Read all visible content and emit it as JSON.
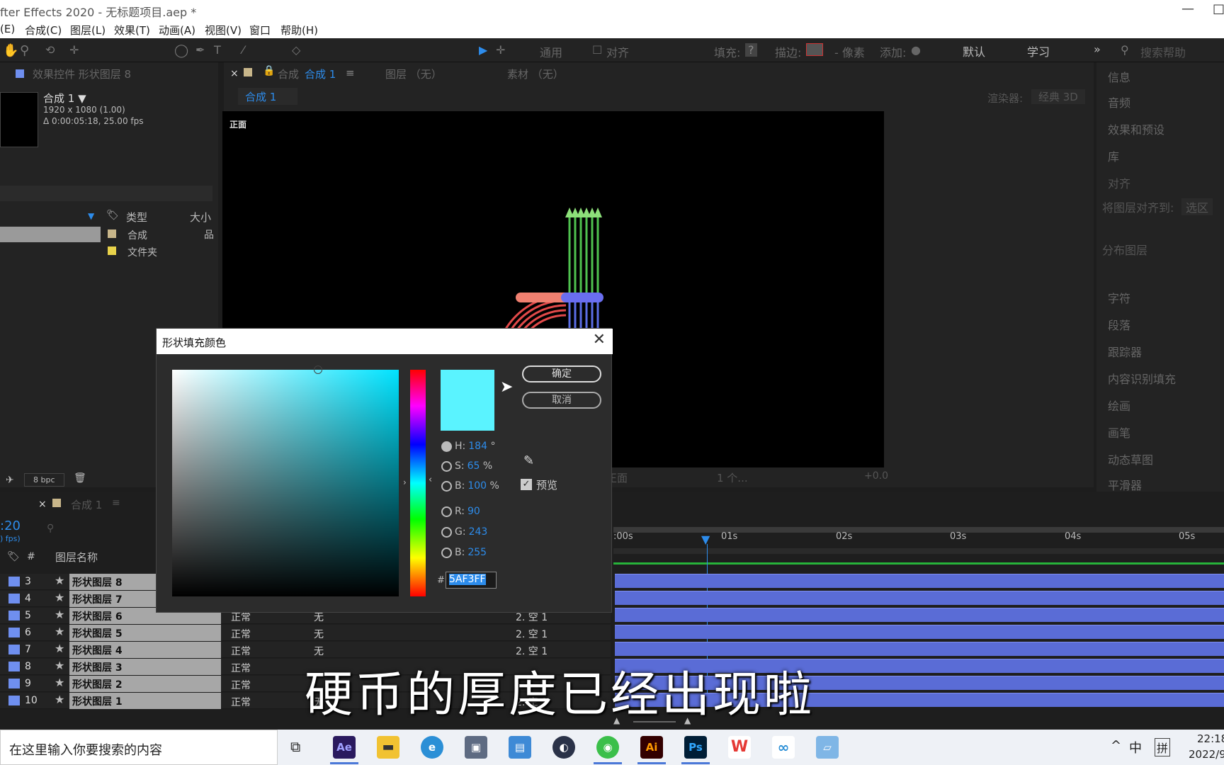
{
  "titlebar": {
    "title": "fter Effects 2020 - 无标题项目.aep *",
    "minimize": "—",
    "maximize": "□"
  },
  "menu": [
    "(E)",
    "合成(C)",
    "图层(L)",
    "效果(T)",
    "动画(A)",
    "视图(V)",
    "窗口",
    "帮助(H)"
  ],
  "toolbar": {
    "generic": "通用",
    "align": "对齐",
    "fill": "填充:",
    "fill_q": "?",
    "stroke": "描边:",
    "px": "- 像素",
    "add": "添加:",
    "workspace_default": "默认",
    "workspace_learn": "学习",
    "more": "»",
    "search_help": "搜索帮助"
  },
  "project": {
    "tab_title": "效果控件 形状图层 8",
    "comp_name": "合成  1 ▼",
    "comp_res": "1920 x 1080 (1.00)",
    "comp_duration": "Δ 0:00:05:18, 25.00 fps",
    "col_type": "类型",
    "col_size": "大小",
    "items": [
      {
        "type": "合成",
        "color": "#c8b68a"
      },
      {
        "type": "文件夹",
        "color": "#e8d24a"
      }
    ],
    "bpc": "8 bpc"
  },
  "comp_panel": {
    "tab_close": "×",
    "tab_comp_prefix": "合成",
    "tab_comp_name": "合成 1",
    "tab_menu": "≡",
    "tab_layer": "图层 （无）",
    "tab_footage": "素材 （无）",
    "subtab": "合成 1",
    "renderer_label": "渲染器:",
    "renderer_value": "经典 3D",
    "view_label": "正面",
    "bottom_view": "正面",
    "bottom_views": "1 个...",
    "bottom_exposure": "+0.0"
  },
  "right_panel": [
    "信息",
    "音频",
    "效果和预设",
    "库",
    "对齐",
    "将图层对齐到:",
    "选区",
    "分布图层",
    "字符",
    "段落",
    "跟踪器",
    "内容识别填充",
    "绘画",
    "画笔",
    "动态草图",
    "平滑器"
  ],
  "timeline": {
    "tab_close": "×",
    "tab_name": "合成 1",
    "tab_menu": "≡",
    "timecode": ":20",
    "fps": ") fps)",
    "col_num": "#",
    "col_name": "图层名称",
    "ruler": [
      ":00s",
      "01s",
      "02s",
      "03s",
      "04s",
      "05s"
    ],
    "layers": [
      {
        "num": "3",
        "name": "形状图层 8",
        "mode": "",
        "track": "",
        "parent": ""
      },
      {
        "num": "4",
        "name": "形状图层 7",
        "mode": "",
        "track": "",
        "parent": ""
      },
      {
        "num": "5",
        "name": "形状图层 6",
        "mode": "正常",
        "track": "无",
        "parent": "2. 空 1"
      },
      {
        "num": "6",
        "name": "形状图层 5",
        "mode": "正常",
        "track": "无",
        "parent": "2. 空 1"
      },
      {
        "num": "7",
        "name": "形状图层 4",
        "mode": "正常",
        "track": "无",
        "parent": "2. 空 1"
      },
      {
        "num": "8",
        "name": "形状图层 3",
        "mode": "正常",
        "track": "无",
        "parent": ""
      },
      {
        "num": "9",
        "name": "形状图层 2",
        "mode": "正常",
        "track": "",
        "parent": ""
      },
      {
        "num": "10",
        "name": "形状图层 1",
        "mode": "正常",
        "track": "无",
        "parent": "2. 空 1"
      }
    ]
  },
  "dialog": {
    "title": "形状填充颜色",
    "close": "✕",
    "ok": "确定",
    "cancel": "取消",
    "color": "#5af3ff",
    "hsb": [
      {
        "label": "H:",
        "value": "184",
        "unit": "°"
      },
      {
        "label": "S:",
        "value": "65",
        "unit": "%"
      },
      {
        "label": "B:",
        "value": "100",
        "unit": "%"
      }
    ],
    "rgb": [
      {
        "label": "R:",
        "value": "90"
      },
      {
        "label": "G:",
        "value": "243"
      },
      {
        "label": "B:",
        "value": "255"
      }
    ],
    "hex_label": "#",
    "hex": "5AF3FF",
    "preview": "预览"
  },
  "subtitle": "硬币的厚度已经出现啦",
  "taskbar": {
    "search": "在这里输入你要搜索的内容",
    "apps": [
      {
        "name": "Ae",
        "color": "#2a1a5e",
        "fg": "#9fa0ff"
      },
      {
        "name": "Ai",
        "color": "#330000",
        "fg": "#ff9a00"
      },
      {
        "name": "Ps",
        "color": "#001e36",
        "fg": "#31a8ff"
      }
    ],
    "ime1": "^",
    "ime2": "中",
    "ime3": "拼",
    "time": "22:18",
    "date": "2022/9"
  }
}
